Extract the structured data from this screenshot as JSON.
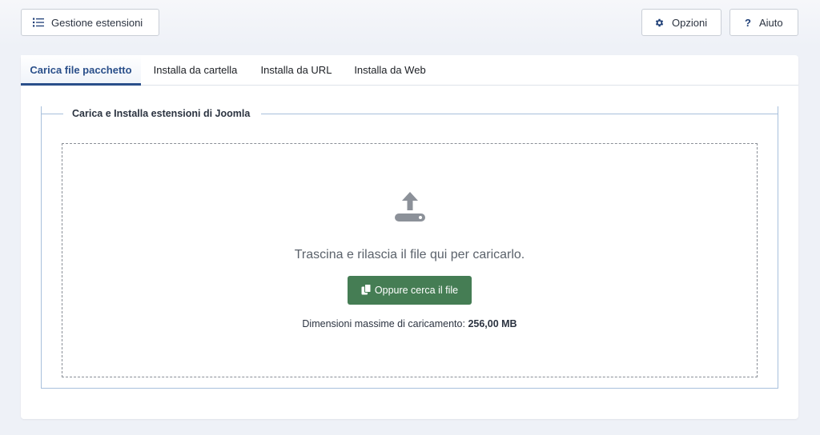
{
  "toolbar": {
    "manage_label": "Gestione estensioni",
    "options_label": "Opzioni",
    "help_label": "Aiuto",
    "help_symbol": "?"
  },
  "tabs": [
    {
      "label": "Carica file pacchetto",
      "active": true
    },
    {
      "label": "Installa da cartella",
      "active": false
    },
    {
      "label": "Installa da URL",
      "active": false
    },
    {
      "label": "Installa da Web",
      "active": false
    }
  ],
  "panel": {
    "legend": "Carica e Installa estensioni di Joomla",
    "drop_text": "Trascina e rilascia il file qui per caricarlo.",
    "browse_label": "Oppure cerca il file",
    "max_size_label": "Dimensioni massime di caricamento:",
    "max_size_value": "256,00 MB"
  },
  "icons": {
    "manage": "list-icon",
    "options": "gear-icon",
    "help": "question-icon",
    "upload": "upload-icon",
    "browse": "copy-icon"
  },
  "colors": {
    "accent": "#2a4f8a",
    "button_green": "#457d54",
    "background": "#eef1f7"
  }
}
